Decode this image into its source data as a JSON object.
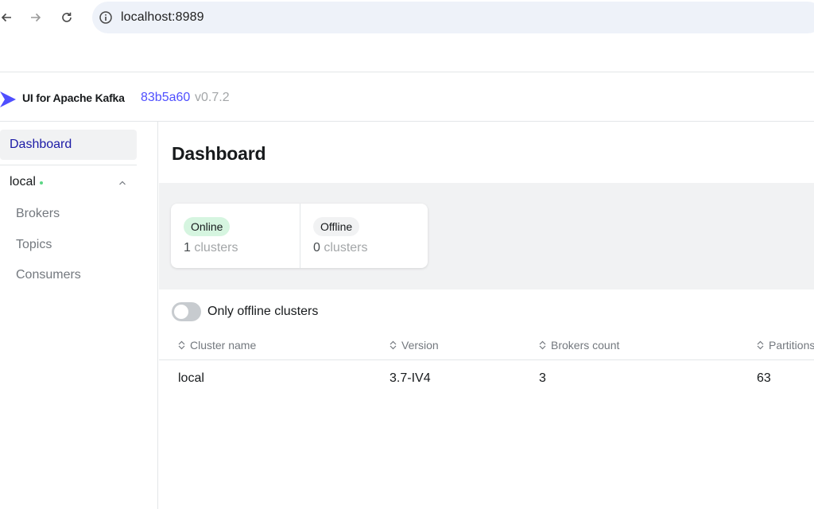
{
  "browser": {
    "url": "localhost:8989"
  },
  "header": {
    "app_title": "UI for Apache Kafka",
    "build_hash": "83b5a60",
    "version": "v0.7.2"
  },
  "sidebar": {
    "dashboard_label": "Dashboard",
    "cluster": {
      "name": "local",
      "status_color": "#5cd685",
      "items": [
        {
          "label": "Brokers"
        },
        {
          "label": "Topics"
        },
        {
          "label": "Consumers"
        }
      ]
    }
  },
  "main": {
    "title": "Dashboard",
    "stats": {
      "online": {
        "badge": "Online",
        "count": "1",
        "unit": "clusters"
      },
      "offline": {
        "badge": "Offline",
        "count": "0",
        "unit": "clusters"
      }
    },
    "toggle": {
      "label": "Only offline clusters",
      "on": false
    },
    "table": {
      "columns": [
        "Cluster name",
        "Version",
        "Brokers count",
        "Partitions"
      ],
      "rows": [
        [
          "local",
          "3.7-IV4",
          "3",
          "63"
        ]
      ]
    }
  },
  "colors": {
    "accent": "#4f4fff",
    "nav_active": "#1c1ba6",
    "online_badge": "#d6f5e0"
  }
}
